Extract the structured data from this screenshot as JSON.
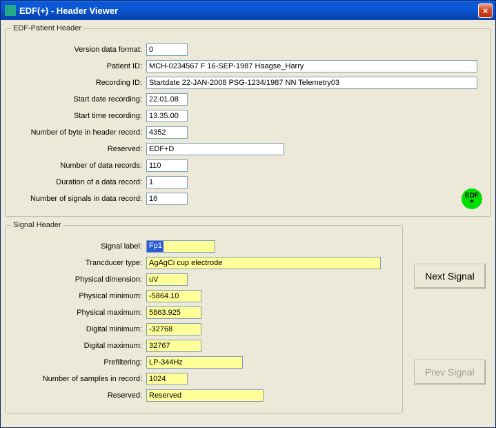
{
  "window": {
    "title": "EDF(+) - Header Viewer",
    "close_label": "×"
  },
  "patient_header": {
    "legend": "EDF-Patient Header",
    "fields": {
      "version_label": "Version data format:",
      "version_value": "0",
      "patient_id_label": "Patient ID:",
      "patient_id_value": "MCH-0234567 F 16-SEP-1987 Haagse_Harry",
      "recording_id_label": "Recording ID:",
      "recording_id_value": "Startdate 22-JAN-2008 PSG-1234/1987 NN Telemetry03",
      "start_date_label": "Start date recording:",
      "start_date_value": "22.01.08",
      "start_time_label": "Start time recording:",
      "start_time_value": "13.35.00",
      "num_bytes_label": "Number of byte in header record:",
      "num_bytes_value": "4352",
      "reserved_label": "Reserved:",
      "reserved_value": "EDF+D",
      "num_records_label": "Number of data records:",
      "num_records_value": "110",
      "duration_label": "Duration of a data record:",
      "duration_value": "1",
      "num_signals_label": "Number of signals in data record:",
      "num_signals_value": "16"
    },
    "badge": "EDF+"
  },
  "signal_header": {
    "legend": "Signal Header",
    "fields": {
      "signal_label_label": "Signal label:",
      "signal_label_value": "Fp1",
      "transducer_label": "Trancducer type:",
      "transducer_value": "AgAgCi cup electrode",
      "phys_dim_label": "Physical dimension:",
      "phys_dim_value": "uV",
      "phys_min_label": "Physical minimum:",
      "phys_min_value": "-5864.10",
      "phys_max_label": "Physical maximum:",
      "phys_max_value": "5863.925",
      "dig_min_label": "Digital minimum:",
      "dig_min_value": "-32768",
      "dig_max_label": "Digital maximum:",
      "dig_max_value": "32767",
      "prefiltering_label": "Prefiltering:",
      "prefiltering_value": "LP-344Hz",
      "num_samples_label": "Number of samples in record:",
      "num_samples_value": "1024",
      "reserved_label": "Reserved:",
      "reserved_value": "Reserved"
    }
  },
  "nav": {
    "next_label": "Next Signal",
    "prev_label": "Prev Signal"
  }
}
